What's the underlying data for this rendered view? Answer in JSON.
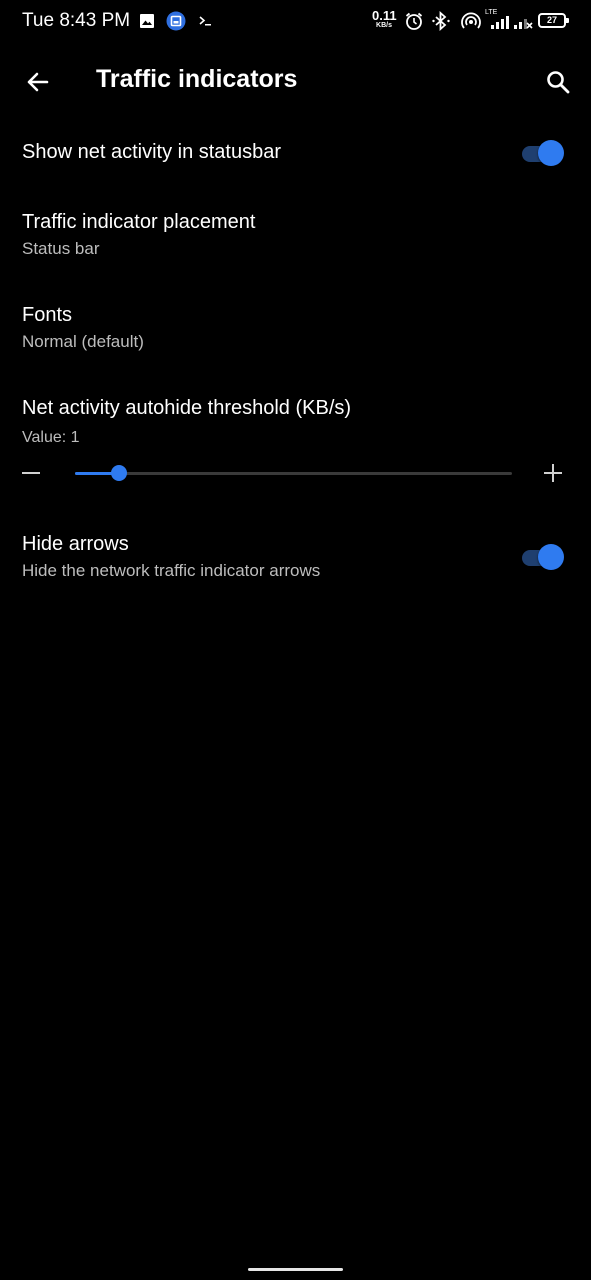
{
  "status_bar": {
    "time": "Tue 8:43 PM",
    "net_speed_value": "0.11",
    "net_speed_unit": "KB/s",
    "battery": "27",
    "network": "LTE",
    "icons": [
      "image-icon",
      "app-notification-icon",
      "terminal-icon",
      "alarm-icon",
      "bluetooth-icon",
      "hotspot-icon",
      "signal-icon",
      "signal-icon-2",
      "battery-icon"
    ]
  },
  "appbar": {
    "title": "Traffic indicators",
    "back_icon": "arrow-back-icon",
    "search_icon": "search-icon"
  },
  "prefs": {
    "show_net_activity": {
      "title": "Show net activity in statusbar",
      "enabled": true
    },
    "placement": {
      "title": "Traffic indicator placement",
      "summary": "Status bar"
    },
    "fonts": {
      "title": "Fonts",
      "summary": "Normal (default)"
    },
    "threshold": {
      "title": "Net activity autohide threshold (KB/s)",
      "summary": "Value: 1",
      "value_fraction": 0.1
    },
    "hide_arrows": {
      "title": "Hide arrows",
      "summary": "Hide the network traffic indicator arrows",
      "enabled": true
    }
  },
  "colors": {
    "background": "#000000",
    "accent": "#2f7bf0",
    "switch_track": "#1f3f6f",
    "summary_text": "#bdbdbd"
  }
}
